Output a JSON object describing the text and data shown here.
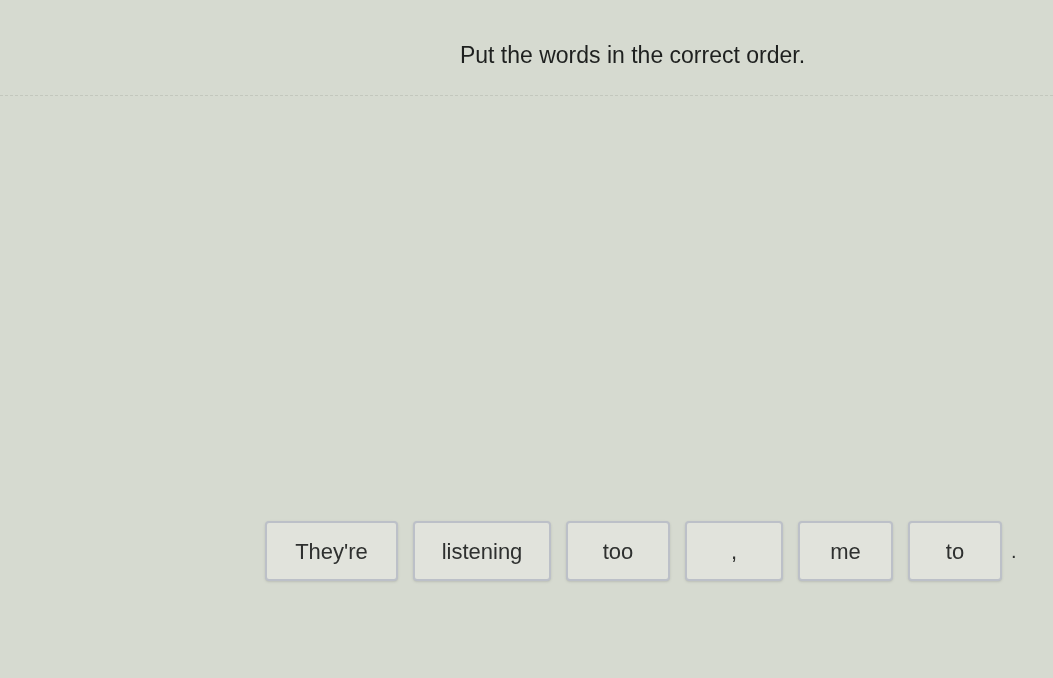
{
  "instruction": "Put the words in the correct order.",
  "word_tiles": [
    {
      "text": "They're"
    },
    {
      "text": "listening"
    },
    {
      "text": "too"
    },
    {
      "text": ","
    },
    {
      "text": "me"
    },
    {
      "text": "to"
    }
  ],
  "sentence_end": "."
}
